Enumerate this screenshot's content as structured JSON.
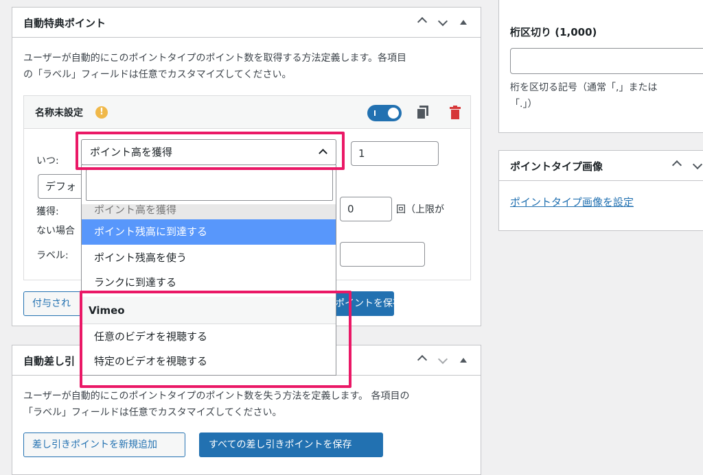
{
  "auto_award": {
    "title": "自動特典ポイント",
    "description_line1": "ユーザーが自動的にこのポイントタイプのポイント数を取得する方法定義します。各項目",
    "description_line2": "の「ラベル」フィールドは任意でカスタマイズしてください。",
    "card": {
      "title": "名称未設定",
      "warning_glyph": "!",
      "when_label": "いつ:",
      "selected_trigger": "ポイント高を獲得",
      "amount_value": "1",
      "default_field_value": "デフォ",
      "earn_label": "獲得:",
      "times_value": "0",
      "times_suffix": "回（上限が",
      "limit_line2": "ない場合",
      "label_label": "ラベル:",
      "label_value": ""
    },
    "add_button": "付与され",
    "save_button": "ポイントを保存"
  },
  "dropdown": {
    "search_value": "",
    "partial_option": "ポイント高を獲得",
    "options": [
      "ポイント残高に到達する",
      "ポイント残高を使う",
      "ランクに到達する"
    ],
    "group_label": "Vimeo",
    "group_options": [
      "任意のビデオを視聴する",
      "特定のビデオを視聴する"
    ]
  },
  "auto_deduct": {
    "title": "自動差し引",
    "description_line1": "ユーザーが自動的にこのポイントタイプのポイント数を失う方法を定義します。 各項目の",
    "description_line2": "「ラベル」フィールドは任意でカスタマイズしてください。",
    "add_button": "差し引きポイントを新規追加",
    "save_button": "すべての差し引きポイントを保存"
  },
  "sidebar": {
    "separator_title": "桁区切り (1,000)",
    "separator_value": "",
    "separator_help_line1": "桁を区切る記号（通常「,」または",
    "separator_help_line2": "「.」）",
    "image_title": "ポイントタイプ画像",
    "image_link": "ポイントタイプ画像を設定"
  },
  "colors": {
    "accent": "#2271b1",
    "highlight_border": "#ea1866",
    "option_hover": "#5897fb",
    "warning": "#f0b849",
    "trash": "#d63638"
  }
}
